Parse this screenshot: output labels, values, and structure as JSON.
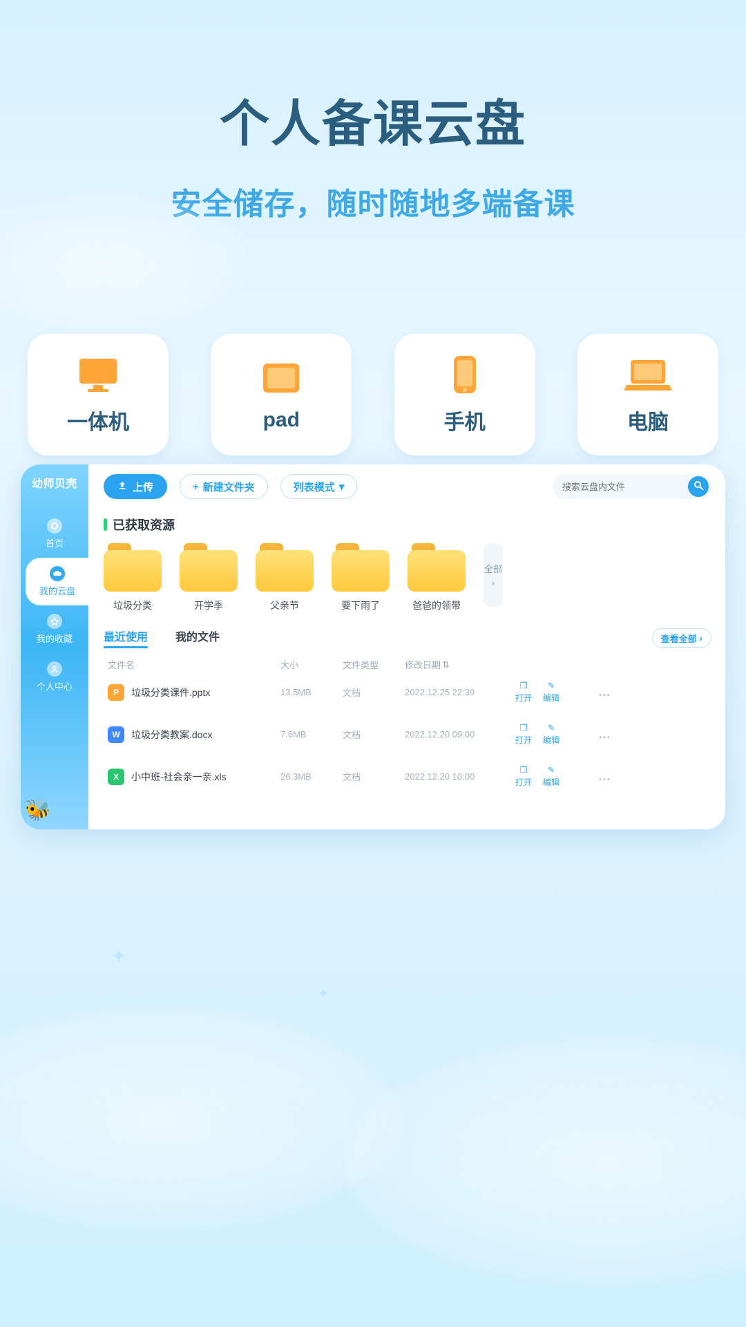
{
  "hero": {
    "title": "个人备课云盘",
    "subtitle": "安全储存，随时随地多端备课"
  },
  "devices": [
    {
      "label": "一体机",
      "icon": "monitor"
    },
    {
      "label": "pad",
      "icon": "tablet"
    },
    {
      "label": "手机",
      "icon": "phone"
    },
    {
      "label": "电脑",
      "icon": "laptop"
    }
  ],
  "brand": "幼师贝壳",
  "sidebar": [
    {
      "label": "首页",
      "id": "home",
      "active": false
    },
    {
      "label": "我的云盘",
      "id": "my-cloud",
      "active": true
    },
    {
      "label": "我的收藏",
      "id": "fav",
      "active": false
    },
    {
      "label": "个人中心",
      "id": "profile",
      "active": false
    }
  ],
  "toolbar": {
    "upload": "上传",
    "new_folder": "新建文件夹",
    "list_mode": "列表模式"
  },
  "search": {
    "placeholder": "搜索云盘内文件"
  },
  "section_title": "已获取资源",
  "folders": [
    {
      "label": "垃圾分类"
    },
    {
      "label": "开学季"
    },
    {
      "label": "父亲节"
    },
    {
      "label": "要下雨了"
    },
    {
      "label": "爸爸的领带"
    }
  ],
  "all_button": "全部",
  "file_tabs": {
    "recent": "最近使用",
    "mine": "我的文件",
    "view_all": "查看全部"
  },
  "columns": {
    "name": "文件名",
    "size": "大小",
    "type": "文件类型",
    "date": "修改日期"
  },
  "op_labels": {
    "open": "打开",
    "edit": "编辑"
  },
  "files": [
    {
      "name": "垃圾分类课件.pptx",
      "size": "13.5MB",
      "type": "文档",
      "date": "2022.12.25 22:39",
      "ft": "p",
      "ftletter": "P"
    },
    {
      "name": "垃圾分类教案.docx",
      "size": "7.6MB",
      "type": "文档",
      "date": "2022.12.20 09:00",
      "ft": "w",
      "ftletter": "W"
    },
    {
      "name": "小中班-社会亲一亲.xls",
      "size": "26.3MB",
      "type": "文档",
      "date": "2022.12.20 10:00",
      "ft": "x",
      "ftletter": "X"
    }
  ]
}
